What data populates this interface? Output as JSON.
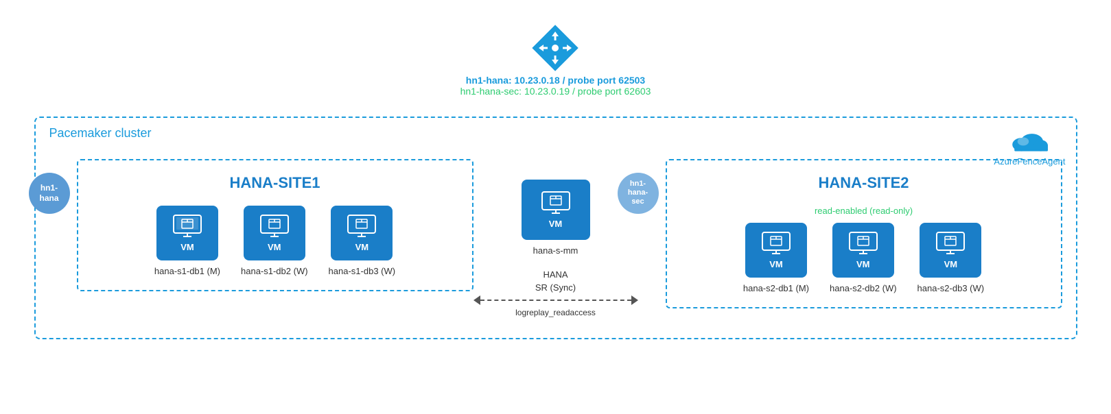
{
  "pacemaker": {
    "label": "Pacemaker cluster"
  },
  "router": {
    "line1": "hn1-hana:  10.23.0.18 / probe port 62503",
    "line2": "hn1-hana-sec:  10.23.0.19 / probe port 62603"
  },
  "azure_fence": {
    "label": "AzureFenceAgent"
  },
  "site1": {
    "title": "HANA-SITE1",
    "node_label": "hn1-\nhana",
    "vms": [
      {
        "name": "hana-s1-db1 (M)"
      },
      {
        "name": "hana-s1-db2 (W)"
      },
      {
        "name": "hana-s1-db3 (W)"
      }
    ]
  },
  "middle": {
    "vm_name": "hana-s-mm",
    "sr_label1": "HANA",
    "sr_label2": "SR (Sync)",
    "logreplay": "logreplay_readaccess"
  },
  "site2": {
    "title": "HANA-SITE2",
    "node_label": "hn1-\nhana-\nsec",
    "read_label": "read-enabled (read-only)",
    "vms": [
      {
        "name": "hana-s2-db1 (M)"
      },
      {
        "name": "hana-s2-db2 (W)"
      },
      {
        "name": "hana-s2-db3 (W)"
      }
    ]
  },
  "vm_inner_label": "VM"
}
